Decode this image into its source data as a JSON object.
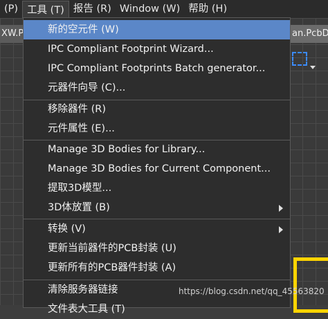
{
  "menubar": {
    "items": [
      {
        "label": "(P)"
      },
      {
        "label": "工具 (T)"
      },
      {
        "label": "报告 (R)"
      },
      {
        "label": "Window (W)"
      },
      {
        "label": "帮助 (H)"
      }
    ]
  },
  "tabs": {
    "left_label": "XW.P",
    "right_label": "an.PcbD"
  },
  "tools_menu": {
    "items": [
      {
        "label": "新的空元件 (W)",
        "highlighted": true
      },
      {
        "label": "IPC Compliant Footprint Wizard..."
      },
      {
        "label": "IPC Compliant Footprints Batch generator..."
      },
      {
        "label": "元器件向导 (C)..."
      },
      {
        "label": "移除器件 (R)"
      },
      {
        "label": "元件属性 (E)..."
      },
      {
        "label": "Manage 3D Bodies for Library..."
      },
      {
        "label": "Manage 3D Bodies for Current Component..."
      },
      {
        "label": "提取3D模型..."
      },
      {
        "label": "3D体放置 (B)",
        "submenu": true
      },
      {
        "label": "转换 (V)",
        "submenu": true
      },
      {
        "label": "更新当前器件的PCB封装 (U)"
      },
      {
        "label": "更新所有的PCB器件封装 (A)"
      },
      {
        "label": "清除服务器链接"
      },
      {
        "label": "文件表大工具 (T)"
      }
    ]
  },
  "watermark": "https://blog.csdn.net/qq_45563820",
  "colors": {
    "highlight": "#5b87c8",
    "menu_bg": "#2d2d2d",
    "board_outline": "#ffd400",
    "selection_tool": "#3b8bff"
  }
}
